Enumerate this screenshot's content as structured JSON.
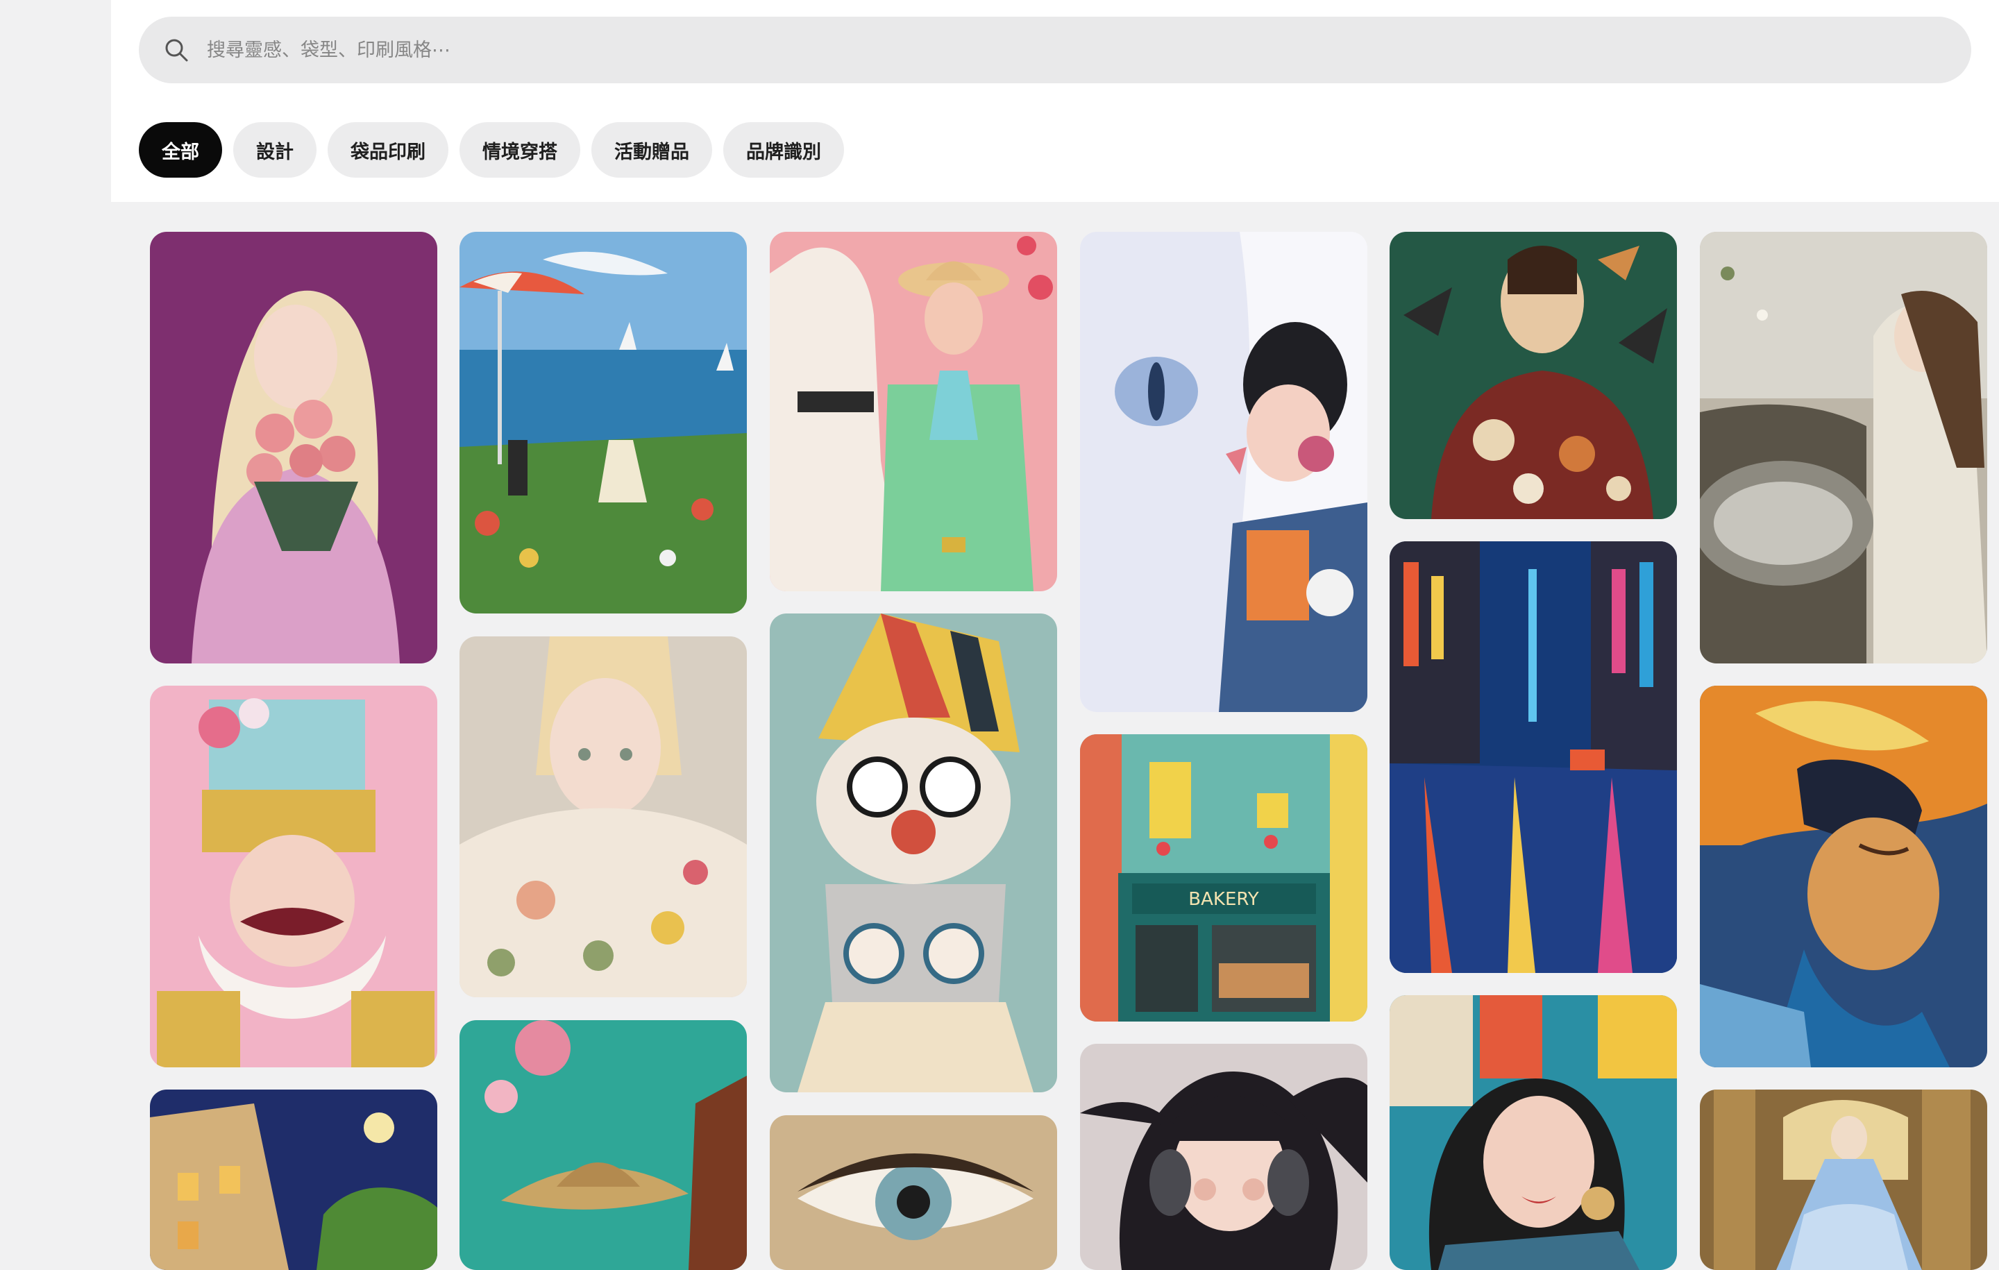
{
  "search": {
    "placeholder": "搜尋靈感、袋型、印刷風格⋯",
    "value": ""
  },
  "filters": [
    {
      "label": "全部",
      "active": true
    },
    {
      "label": "設計",
      "active": false
    },
    {
      "label": "袋品印刷",
      "active": false
    },
    {
      "label": "情境穿搭",
      "active": false
    },
    {
      "label": "活動贈品",
      "active": false
    },
    {
      "label": "品牌識別",
      "active": false
    }
  ],
  "gallery": {
    "shop_sign": "BAKERY",
    "items": [
      {
        "name": "pin-girl-roses",
        "colors": [
          "#7e2f6f",
          "#e6c4d8",
          "#f0d7ae"
        ]
      },
      {
        "name": "pin-nutcracker",
        "colors": [
          "#f2b3c6",
          "#dcb44c",
          "#c43b45"
        ]
      },
      {
        "name": "pin-night-street",
        "colors": [
          "#1f2d6a",
          "#e2b05a",
          "#58893a"
        ]
      },
      {
        "name": "pin-seaside-garden",
        "colors": [
          "#4b8cc0",
          "#4e8a3b",
          "#dc5540"
        ]
      },
      {
        "name": "pin-floral-girl",
        "colors": [
          "#d8cfc2",
          "#e6a487",
          "#8fa06b"
        ]
      },
      {
        "name": "pin-cowboy-hat",
        "colors": [
          "#2fa797",
          "#e58aa0",
          "#c9a565"
        ]
      },
      {
        "name": "pin-horse-cowgirl",
        "colors": [
          "#f1a8ac",
          "#7bcf9a",
          "#f4ece4"
        ]
      },
      {
        "name": "pin-clown-girl",
        "colors": [
          "#98bdb8",
          "#e9c24a",
          "#d1503e"
        ]
      },
      {
        "name": "pin-eye-closeup",
        "colors": [
          "#cdb38c",
          "#3a2a1e",
          "#7aa6b0"
        ]
      },
      {
        "name": "pin-cat-kiss",
        "colors": [
          "#f0f0f6",
          "#9bb3da",
          "#3d5e8f"
        ]
      },
      {
        "name": "pin-bakery-storefront",
        "colors": [
          "#6ab8ae",
          "#1f6b68",
          "#f1d24a"
        ]
      },
      {
        "name": "pin-headphone-girl",
        "colors": [
          "#d8cfcf",
          "#201c22",
          "#e7b5a6"
        ]
      },
      {
        "name": "pin-woman-birds",
        "colors": [
          "#245845",
          "#7b2a24",
          "#e7c8a3"
        ]
      },
      {
        "name": "pin-rainy-city",
        "colors": [
          "#153a78",
          "#e85a35",
          "#2fa0d8"
        ]
      },
      {
        "name": "pin-magazine-girl",
        "colors": [
          "#2a8fa4",
          "#e45a3b",
          "#1c1c1c"
        ]
      },
      {
        "name": "pin-fountain-lady",
        "colors": [
          "#bdb6a8",
          "#5a5448",
          "#e9e4d8"
        ]
      },
      {
        "name": "pin-painted-man",
        "colors": [
          "#2a4c7c",
          "#e5892b",
          "#f2d36b"
        ]
      },
      {
        "name": "pin-ballroom-dancer",
        "colors": [
          "#8a6a3c",
          "#9cc0e6",
          "#e9d49a"
        ]
      }
    ]
  }
}
